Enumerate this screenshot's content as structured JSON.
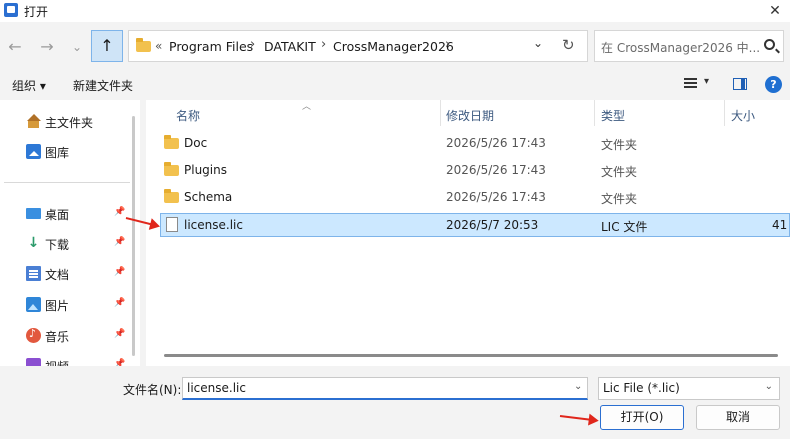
{
  "window": {
    "title": "打开",
    "close_glyph": "✕"
  },
  "nav": {
    "back": "←",
    "forward": "→",
    "recent": "⌄",
    "up": "↑",
    "address": {
      "lead": "«",
      "crumbs": [
        "Program Files",
        "DATAKIT",
        "CrossManager2026"
      ],
      "separator": "›",
      "dropdown": "⌄",
      "refresh": "↻"
    },
    "search_placeholder": "在 CrossManager2026 中..."
  },
  "toolbar": {
    "organize": "组织 ▾",
    "new_folder": "新建文件夹"
  },
  "sidebar": {
    "items": [
      {
        "label": "主文件夹",
        "icon": "home-icon",
        "pinned": false
      },
      {
        "label": "图库",
        "icon": "gallery-icon",
        "pinned": false
      },
      {
        "label": "桌面",
        "icon": "desktop-icon",
        "pinned": true
      },
      {
        "label": "下载",
        "icon": "download-icon",
        "pinned": true
      },
      {
        "label": "文档",
        "icon": "document-icon",
        "pinned": true
      },
      {
        "label": "图片",
        "icon": "pictures-icon",
        "pinned": true
      },
      {
        "label": "音乐",
        "icon": "music-icon",
        "pinned": true
      },
      {
        "label": "视频",
        "icon": "video-icon",
        "pinned": true
      }
    ]
  },
  "files": {
    "columns": [
      "名称",
      "修改日期",
      "类型",
      "大小"
    ],
    "rows": [
      {
        "name": "Doc",
        "date": "2026/5/26 17:43",
        "type": "文件夹",
        "size": "",
        "kind": "folder"
      },
      {
        "name": "Plugins",
        "date": "2026/5/26 17:43",
        "type": "文件夹",
        "size": "",
        "kind": "folder"
      },
      {
        "name": "Schema",
        "date": "2026/5/26 17:43",
        "type": "文件夹",
        "size": "",
        "kind": "folder"
      },
      {
        "name": "license.lic",
        "date": "2026/5/7 20:53",
        "type": "LIC 文件",
        "size": "41",
        "kind": "file"
      }
    ]
  },
  "bottom": {
    "filename_label": "文件名(N):",
    "filename_value": "license.lic",
    "filetype": "Lic File (*.lic)",
    "open_label": "打开(O)",
    "cancel_label": "取消"
  },
  "colors": {
    "accent": "#2b6fd1",
    "selection": "#cce8ff",
    "annotation_arrow": "#e0261b"
  }
}
